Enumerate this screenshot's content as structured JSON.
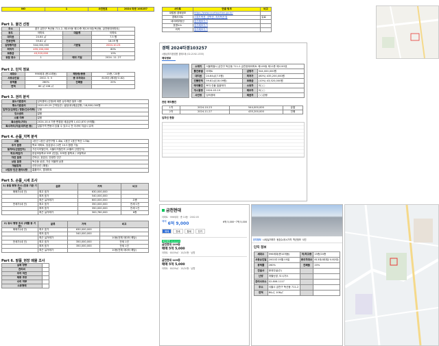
{
  "header": {
    "no_label": "NO",
    "no_value": "1",
    "case_label": "사건번호",
    "case_value": "2024 타경 103257"
  },
  "part1": {
    "title": "Part 1. 물건 선정",
    "rows": [
      {
        "k": "주소",
        "v": "경기 금천구 독산동 711-2, 제105동 제12층 제1203호(독산동, 금천현대아파트)"
      },
      {
        "k": "용도",
        "v": "아파트",
        "k2": "대분류",
        "v2": "아파트"
      },
      {
        "k": "대지권",
        "v": "24.64 ㎡",
        "k2": "",
        "v2": "7.5 평"
      },
      {
        "k": "전용면적",
        "v": "59.82 ㎡",
        "k2": "",
        "v2": "18.09 평"
      },
      {
        "k": "감정평가금",
        "v": "544,000,000",
        "k2": "기준일",
        "v2": "2024.10.23"
      },
      {
        "k": "최저가",
        "v": "435,200,000",
        "k2": "",
        "v2": "80%"
      },
      {
        "k": "보증금",
        "v": "43,520,000",
        "k2": "",
        "v2": "10%"
      },
      {
        "k": "유찰 횟수",
        "v": "1",
        "k2": "매각 기일",
        "v2": "2024. 11. 27"
      }
    ]
  },
  "part2": {
    "title": "Part 2. 단지 정보",
    "rows": [
      {
        "k": "세대수",
        "v": "996세대 (총10개동)",
        "k2": "해당층/총층",
        "v2": "15층 / 20층"
      },
      {
        "k": "사용승인일",
        "v": "2002. 5. 5",
        "k2": "총 주차대수",
        "v2": "813대 (세대당 0.82)"
      },
      {
        "k": "용적률",
        "v": "260%",
        "k2": "건폐율",
        "v2": "20%"
      },
      {
        "k": "면적",
        "v": "80 ㎡ 108 ㎡",
        "k2": "",
        "v2": ""
      }
    ]
  },
  "part3": {
    "title": "Part 3. 권리 분석",
    "rows": [
      {
        "k": "말소기준권리",
        "v": "임의경매 (신청)에 대한 상주채권 일부 사용"
      },
      {
        "k": "평소기준권리",
        "v": "2020-09-29 근저당권 / 설정(위)예금은행 / 18,800,000원"
      },
      {
        "k": "임차인(임대인) 현황(인수여부)",
        "v": "있음"
      },
      {
        "k": "인수권리",
        "v": "없음"
      },
      {
        "k": "소멸 여부",
        "v": "없음"
      },
      {
        "k": "특수권리(기타)",
        "v": "2024-10-4 기준 변경된 세금금액 1,412,870 (9개월)"
      },
      {
        "k": "특수처리(지분/대지권 등)",
        "v": "입찰가격 변동이 있을 수 있으니 전 이사비 지급시 유의"
      }
    ]
  },
  "part4": {
    "title": "Part 4. 손품_지역 분석",
    "rows": [
      {
        "k": "교통",
        "v": "1호선 1호선 금천구청 1.4㎞, 1호선 1호선 독산 1.5㎞"
      },
      {
        "k": "주거 환경",
        "v": "학교 아파트, 당금공시 (시민 10.5 환경 기능"
      },
      {
        "k": "일자리(산업단지)",
        "v": "가산디지털단지, 서울디지털단지 (G밸리 산업단지)"
      },
      {
        "k": "학교/학원가",
        "v": "문성초등학교 도보 (인접), 도보권 중학교 / 고등학교"
      },
      {
        "k": "자연 환경",
        "v": "관악산, 호암산, 안양천 인근"
      },
      {
        "k": "상권 환경",
        "v": "독산동 상권, 가산 아울렛 상권"
      },
      {
        "k": "개발호재",
        "v": "신안산선 (예정)"
      },
      {
        "k": "사업장 인근 편의사항",
        "v": "홈플러스, 롯데마트"
      }
    ]
  },
  "part5a": {
    "title": "Part 5. 손품_시세 조사",
    "subtitle": "1) 동일 평형 조사 (전용 기준 기준)",
    "cols": [
      "분류",
      "가격",
      "비고"
    ],
    "rows": [
      {
        "g": "매매가(네 건)",
        "k": "최고 호가",
        "v": "630,000,000",
        "n": ""
      },
      {
        "g": "",
        "k": "최저 호가",
        "v": "540,000,000",
        "n": ""
      },
      {
        "g": "",
        "k": "최근 실거래가",
        "v": "600,000,000",
        "n": "고층"
      },
      {
        "g": "전세가(네 건)",
        "k": "최고 호가",
        "v": "350,000,000",
        "n": "전세 1건"
      },
      {
        "g": "",
        "k": "최저 호가",
        "v": "350,000,000",
        "n": "전세 1건"
      },
      {
        "g": "",
        "k": "최근 실거래가",
        "v": "300,760,000",
        "n": "8층"
      }
    ]
  },
  "part5b": {
    "subtitle": "2) 유사 평형 조사 (매물 동 기준)",
    "cols": [
      "분류",
      "가격",
      "비고"
    ],
    "rows": [
      {
        "g": "매매가(네 건)",
        "k": "최고 호가",
        "v": "630,000,000",
        "n": ""
      },
      {
        "g": "",
        "k": "최저 호가",
        "v": "540,000,000",
        "n": ""
      },
      {
        "g": "",
        "k": "최근 실거래가",
        "v": "",
        "n": "10동(전체 데이터 해당)"
      },
      {
        "g": "전세가(네 건)",
        "k": "최고 호가",
        "v": "350,000,000",
        "n": "전세 1건"
      },
      {
        "g": "",
        "k": "최저 호가",
        "v": "350,000,000",
        "n": "전세 1건"
      },
      {
        "g": "",
        "k": "최근 실거래가",
        "v": "",
        "n": "10동(전체 데이터 해당)"
      }
    ]
  },
  "part6": {
    "title": "Part 6. 발품_현장 매물 조사",
    "rows": [
      "실제 방향",
      "관리비",
      "주차 여건",
      "채광 조망",
      "수리 여부",
      "소유형태"
    ]
  },
  "sites": {
    "cols": [
      "사이트",
      "연결 링크",
      "비고"
    ],
    "rows": [
      {
        "k": "대법원 경매정보",
        "v": "https://www.courtauction.go.kr/",
        "n": ""
      },
      {
        "k": "경매사이트",
        "v": "스피드옥션, 굿옥션, 지지옥션 등",
        "n": "유료"
      },
      {
        "k": "네이버부동산",
        "v": "참가해보기기",
        "n": ""
      },
      {
        "k": "호갱노노",
        "v": "참가해보기기",
        "n": ""
      },
      {
        "k": "리치",
        "v": "참가해보기기",
        "n": ""
      }
    ]
  },
  "auction_page": {
    "title": "경매 2024타경103257",
    "subtitle": "서울남부지방법원 경매3계 (02-2192-1333)",
    "tab_info": "매각정보",
    "section_history": "관련 매각물건",
    "section_rights": "임차인 현황",
    "summary_rows": [
      [
        "소재지",
        "서울특별시 금천구 독산동 711-2 금천현대아파트 제105동 제12층 제1203호"
      ],
      [
        "물건종별",
        "아파트",
        "감정가",
        "544,000,000원"
      ],
      [
        "대지권",
        "24.64㎡(7.5평)",
        "최저가",
        "(80%) 435,200,000원"
      ],
      [
        "건물면적",
        "59.82㎡(18.09평)",
        "보증금",
        "(10%) 43,520,000원"
      ],
      [
        "매각물건",
        "토지·건물 일괄매각",
        "소유자",
        "이○○"
      ],
      [
        "개시결정",
        "2024-03-19",
        "채무자",
        "이○○"
      ],
      [
        "사건명",
        "임의경매",
        "채권자",
        "○○은행"
      ]
    ],
    "history_rows": [
      [
        "1차",
        "2024-10-23",
        "544,000,000",
        "유찰"
      ],
      [
        "2차",
        "2024-11-27",
        "435,200,000",
        "진행"
      ]
    ]
  },
  "naver": {
    "title": "금천현대",
    "meta": "아파트 · 996세대 · 총 10동 · 2002.05",
    "tabs": [
      "매매",
      "전세",
      "월세",
      "단기"
    ],
    "price_label": "매매",
    "price": "6억 9,000",
    "price2": "6억 5,000~7억 5,000",
    "listing1": {
      "name": "금천현대 109동",
      "price": "매매 5억 5,000",
      "desc": "아파트 · 80/59㎡ · 10/20층 · 남향"
    },
    "listing2": {
      "name": "금천현대 109동",
      "price": "매매 5억 5,000",
      "desc": "아파트 · 80/59㎡ · 15/20층 · 남향"
    },
    "badge": "확인매물 24.10.23",
    "tabs2": [
      "단지정보",
      "시세/실거래가",
      "동호수/공시가격",
      "학군정보",
      "사진"
    ],
    "panel_title": "단지 정보",
    "info_rows": [
      [
        "세대수",
        "996세대(총10개동)",
        "저/최고층",
        "15층/20층"
      ],
      [
        "사용승인일",
        "2002년 05월 05일",
        "총주차대수",
        "813대(세대당 0.82대)"
      ],
      [
        "용적률",
        "260%",
        "건폐율",
        "20%"
      ],
      [
        "건설사",
        "현대건설(주)",
        "",
        ""
      ],
      [
        "난방",
        "개별난방, 도시가스",
        "",
        ""
      ],
      [
        "관리사무소",
        "02-806-1117",
        "",
        ""
      ],
      [
        "주소",
        "서울시 금천구 독산동 711-2",
        "",
        ""
      ],
      [
        "면적",
        "80㎡, 108㎡",
        "",
        ""
      ]
    ]
  }
}
